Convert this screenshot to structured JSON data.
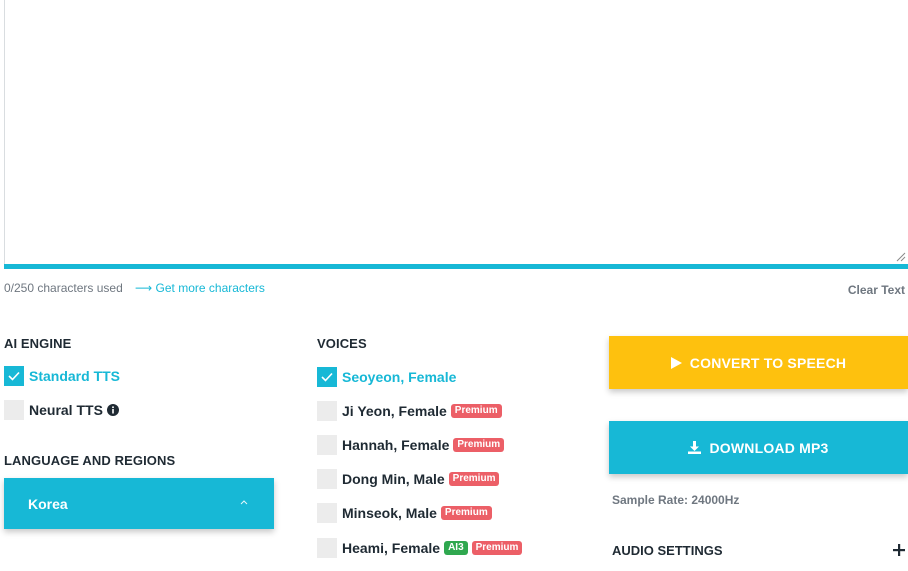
{
  "editor": {
    "value": "",
    "char_count": "0/250 characters used",
    "get_more": "Get more characters",
    "clear": "Clear Text"
  },
  "ai_engine": {
    "title": "AI ENGINE",
    "options": [
      {
        "label": "Standard TTS",
        "checked": true
      },
      {
        "label": "Neural TTS",
        "checked": false,
        "icon": "info-icon"
      }
    ]
  },
  "language": {
    "title": "LANGUAGE AND REGIONS",
    "selected": "Korea"
  },
  "voices": {
    "title": "VOICES",
    "items": [
      {
        "label": "Seoyeon, Female",
        "checked": true,
        "badges": []
      },
      {
        "label": "Ji Yeon, Female",
        "checked": false,
        "badges": [
          "Premium"
        ]
      },
      {
        "label": "Hannah, Female",
        "checked": false,
        "badges": [
          "Premium"
        ]
      },
      {
        "label": "Dong Min, Male",
        "checked": false,
        "badges": [
          "Premium"
        ]
      },
      {
        "label": "Minseok, Male",
        "checked": false,
        "badges": [
          "Premium"
        ]
      },
      {
        "label": "Heami, Female",
        "checked": false,
        "badges": [
          "AI3",
          "Premium"
        ]
      }
    ]
  },
  "actions": {
    "convert": "CONVERT TO SPEECH",
    "download": "DOWNLOAD MP3",
    "sample_rate": "Sample Rate: 24000Hz",
    "audio_settings": "AUDIO SETTINGS"
  },
  "colors": {
    "accent": "#17b8d6",
    "convert_button": "#fec10e",
    "premium_badge": "#ec5f67",
    "ai_badge": "#2fa84f"
  }
}
